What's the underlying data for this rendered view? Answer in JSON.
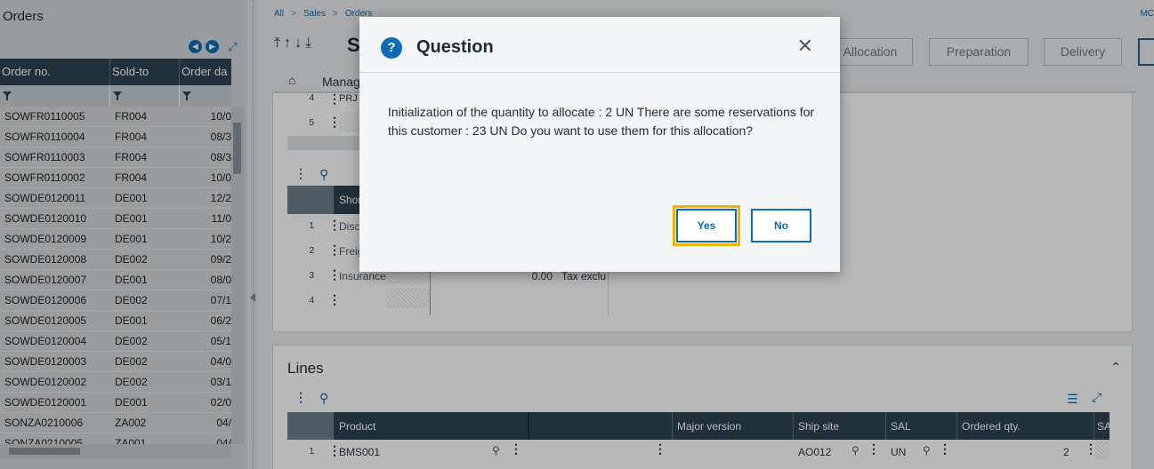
{
  "left_panel": {
    "title": "Orders",
    "columns": [
      "Order no.",
      "Sold-to",
      "Order da"
    ],
    "rows": [
      [
        "SOWFR0110005",
        "FR004",
        "10/0"
      ],
      [
        "SOWFR0110004",
        "FR004",
        "08/3"
      ],
      [
        "SOWFR0110003",
        "FR004",
        "08/3"
      ],
      [
        "SOWFR0110002",
        "FR004",
        "10/0"
      ],
      [
        "SOWDE0120011",
        "DE001",
        "12/2"
      ],
      [
        "SOWDE0120010",
        "DE001",
        "11/0"
      ],
      [
        "SOWDE0120009",
        "DE001",
        "10/2"
      ],
      [
        "SOWDE0120008",
        "DE002",
        "09/2"
      ],
      [
        "SOWDE0120007",
        "DE001",
        "08/0"
      ],
      [
        "SOWDE0120006",
        "DE002",
        "07/1"
      ],
      [
        "SOWDE0120005",
        "DE001",
        "06/2"
      ],
      [
        "SOWDE0120004",
        "DE002",
        "05/1"
      ],
      [
        "SOWDE0120003",
        "DE002",
        "04/0"
      ],
      [
        "SOWDE0120002",
        "DE002",
        "03/1"
      ],
      [
        "SOWDE0120001",
        "DE001",
        "02/0"
      ],
      [
        "SONZA0210006",
        "ZA002",
        "04/"
      ],
      [
        "SONZA0210005",
        "ZA001",
        "04/"
      ]
    ]
  },
  "breadcrumb": [
    "All",
    "Sales",
    "Orders"
  ],
  "top_right_label": "MC",
  "page_title_partial": "S",
  "toolbar": {
    "allocation": "Allocation",
    "preparation": "Preparation",
    "delivery": "Delivery"
  },
  "tab_label_partial": "Manag",
  "upper_grid": {
    "rows": [
      {
        "n": "4",
        "text": "PRJ"
      },
      {
        "n": "5",
        "text": ""
      }
    ]
  },
  "charges_grid": {
    "header": "Shor",
    "rows": [
      {
        "n": "1",
        "text": "Disc",
        "amount": "",
        "tax": ""
      },
      {
        "n": "2",
        "text": "Freig",
        "amount": "",
        "tax": ""
      },
      {
        "n": "3",
        "text": "Insurance",
        "amount": "0.00",
        "tax": "Tax exclu"
      },
      {
        "n": "4",
        "text": "",
        "amount": "",
        "tax": ""
      }
    ]
  },
  "lines_section": {
    "title": "Lines",
    "columns": {
      "product": "Product",
      "major_version": "Major version",
      "ship_site": "Ship site",
      "sal": "SAL",
      "ordered_qty": "Ordered qty.",
      "sa": "SA"
    },
    "row": {
      "n": "1",
      "product": "BMS001",
      "ship_site": "AO012",
      "sal": "UN",
      "ordered_qty": "2"
    }
  },
  "dialog": {
    "title": "Question",
    "message": "Initialization of the quantity to allocate : 2 UN There are some reservations for this customer : 23 UN Do you want to use them for this allocation?",
    "yes_label": "Yes",
    "no_label": "No",
    "accent": "#0c6cb5",
    "focus_color": "#f0b400"
  }
}
